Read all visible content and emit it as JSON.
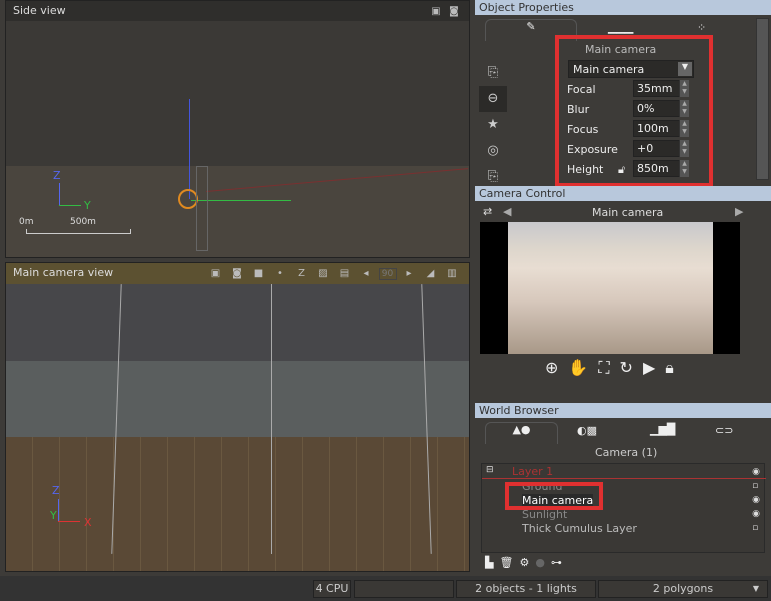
{
  "side_view": {
    "title": "Side view",
    "axis_z": "Z",
    "axis_y": "Y",
    "scale_start": "0m",
    "scale_end": "500m"
  },
  "camera_view": {
    "title": "Main camera view",
    "axis_z": "Z",
    "axis_y": "Y",
    "axis_x": "X",
    "toolbar_z": "Z",
    "frame_value": "90"
  },
  "object_properties": {
    "title": "Object Properties",
    "camera_heading": "Main camera",
    "camera_select": "Main camera",
    "fields": [
      {
        "label": "Focal",
        "value": "35mm"
      },
      {
        "label": "Blur",
        "value": "0%"
      },
      {
        "label": "Focus",
        "value": "100m"
      },
      {
        "label": "Exposure",
        "value": "+0"
      },
      {
        "label": "Height",
        "value": "850m"
      }
    ]
  },
  "camera_control": {
    "title": "Camera Control",
    "camera_name": "Main camera"
  },
  "world_browser": {
    "title": "World Browser",
    "filter_label": "Camera (1)",
    "layer": "Layer 1",
    "items": [
      "Ground",
      "Main camera",
      "Sunlight",
      "Thick Cumulus Layer"
    ]
  },
  "status": {
    "cpu": "4 CPU",
    "objects": "2 objects - 1 lights",
    "polygons": "2 polygons"
  },
  "colors": {
    "highlight": "#e03030",
    "header": "#b8c8dc"
  }
}
